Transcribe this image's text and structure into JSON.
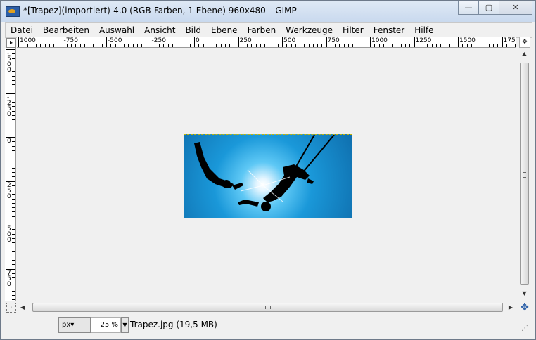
{
  "window": {
    "title": "*[Trapez](importiert)-4.0 (RGB-Farben, 1 Ebene) 960x480 – GIMP",
    "minimize": "—",
    "maximize": "▢",
    "close": "✕"
  },
  "menu": [
    "Datei",
    "Bearbeiten",
    "Auswahl",
    "Ansicht",
    "Bild",
    "Ebene",
    "Farben",
    "Werkzeuge",
    "Filter",
    "Fenster",
    "Hilfe"
  ],
  "ruler": {
    "horizontal_labels": [
      "1000",
      "-750",
      "-500",
      "-250",
      "0",
      "250",
      "500",
      "750",
      "1000",
      "1250",
      "1500",
      "1750"
    ],
    "vertical_labels": [
      "-500",
      "-250",
      "0",
      "250",
      "500",
      "750"
    ]
  },
  "status": {
    "unit": "px",
    "zoom": "25 %",
    "file_info": "Trapez.jpg (19,5 MB)"
  },
  "icons": {
    "app": "gimp-icon",
    "nav": "navigate-icon",
    "quickmask": "quickmask-icon",
    "move": "move-icon"
  }
}
